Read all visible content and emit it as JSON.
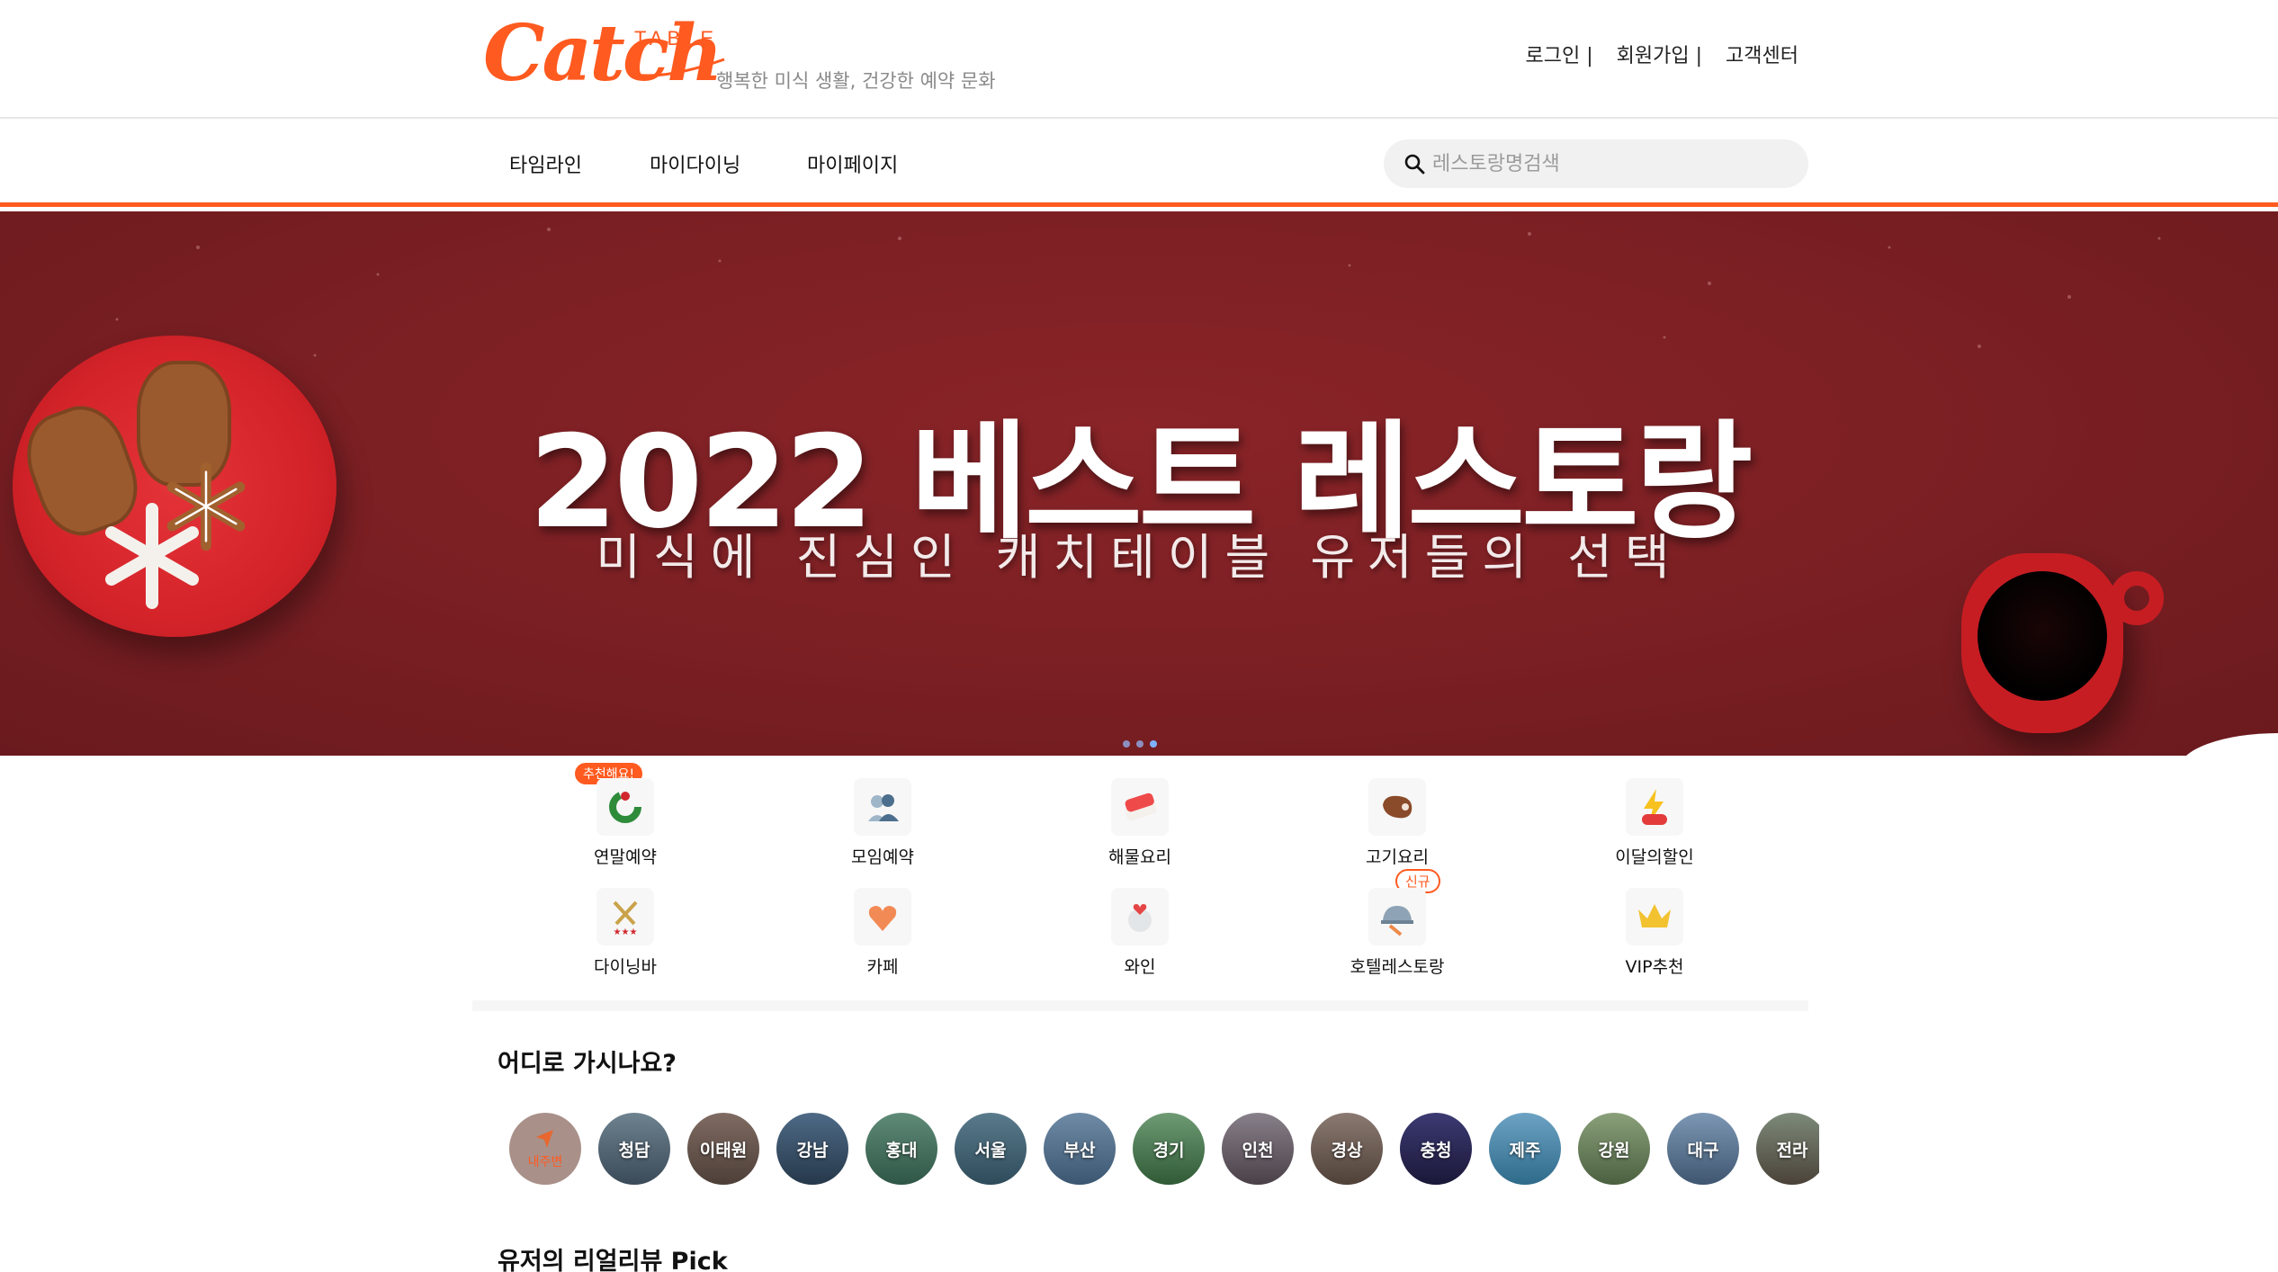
{
  "header": {
    "logo_script": "Catch",
    "logo_table": "TABLE",
    "tagline": "행복한 미식 생활, 건강한 예약 문화",
    "links": [
      "로그인 |",
      "회원가입 |",
      "고객센터"
    ]
  },
  "nav": {
    "items": [
      "타임라인",
      "마이다이닝",
      "마이페이지"
    ],
    "search_placeholder": "레스토랑명검색"
  },
  "banner": {
    "title": "2022 베스트 레스토랑",
    "subtitle": "미식에 진심인 캐치테이블 유저들의 선택",
    "slide_count": 3,
    "active_slide": 3
  },
  "categories": [
    {
      "label": "연말예약",
      "icon": "wreath-icon",
      "badge": "추천해요!"
    },
    {
      "label": "모임예약",
      "icon": "group-icon"
    },
    {
      "label": "해물요리",
      "icon": "seafood-icon"
    },
    {
      "label": "고기요리",
      "icon": "meat-icon"
    },
    {
      "label": "이달의할인",
      "icon": "sale-lightning-icon"
    },
    {
      "label": "다이닝바",
      "icon": "fork-knife-icon"
    },
    {
      "label": "카페",
      "icon": "heart-cup-icon"
    },
    {
      "label": "와인",
      "icon": "wine-glass-icon"
    },
    {
      "label": "호텔레스토랑",
      "icon": "cloche-icon",
      "badge": "신규"
    },
    {
      "label": "VIP추천",
      "icon": "crown-icon"
    }
  ],
  "regions_section": {
    "title": "어디로 가시나요?",
    "near_label": "내주변",
    "items": [
      "청담",
      "이태원",
      "강남",
      "홍대",
      "서울",
      "부산",
      "경기",
      "인천",
      "경상",
      "충청",
      "제주",
      "강원",
      "대구",
      "전라"
    ]
  },
  "review_section": {
    "title": "유저의 리얼리뷰 Pick"
  },
  "colors": {
    "brand": "#ff5a1f",
    "banner_bg": "#7a1f23"
  }
}
